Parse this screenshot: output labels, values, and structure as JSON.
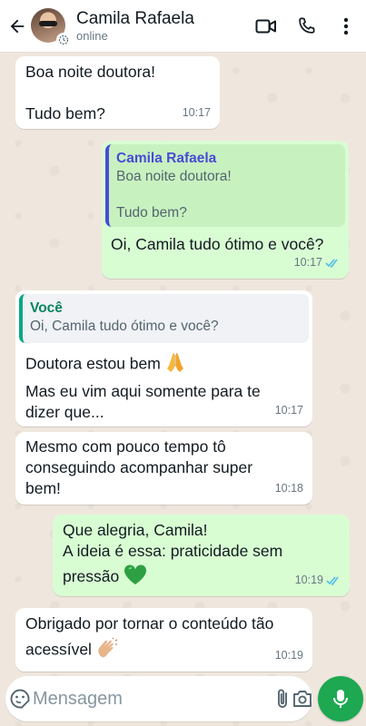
{
  "header": {
    "contact_name": "Camila Rafaela",
    "status": "online"
  },
  "messages": [
    {
      "direction": "in",
      "lines": [
        "Boa noite doutora!",
        "",
        "Tudo bem?"
      ],
      "time": "10:17"
    },
    {
      "direction": "out",
      "quote": {
        "author": "Camila Rafaela",
        "text_line1": "Boa noite doutora!",
        "text_line2": "Tudo bem?"
      },
      "text": "Oi, Camila tudo ótimo e você?",
      "time": "10:17",
      "read": true
    },
    {
      "direction": "in",
      "quote": {
        "author": "Você",
        "text": "Oi, Camila tudo ótimo e você?"
      },
      "line1": "Doutora estou bem",
      "line1_emoji": "🙏",
      "line2": "Mas eu vim aqui somente para te",
      "line3": "dizer que...",
      "time": "10:17"
    },
    {
      "direction": "in",
      "line1": "Mesmo com pouco tempo tô",
      "line2": "conseguindo acompanhar super",
      "line3": "bem!",
      "time": "10:18"
    },
    {
      "direction": "out",
      "line1": "Que alegria, Camila!",
      "line2": "A ideia é essa: praticidade sem",
      "line3": "pressão",
      "line3_emoji": "💚",
      "time": "10:19",
      "read": true
    },
    {
      "direction": "in",
      "line1": "Obrigado por tornar o conteúdo tão",
      "line2": "acessível",
      "line2_emoji": "👏",
      "time": "10:19"
    }
  ],
  "composer": {
    "placeholder": "Mensagem"
  },
  "colors": {
    "accent": "#1da851",
    "outgoing_bubble": "#d9fdd3",
    "read_ticks": "#53bdeb",
    "background": "#efe7de"
  }
}
